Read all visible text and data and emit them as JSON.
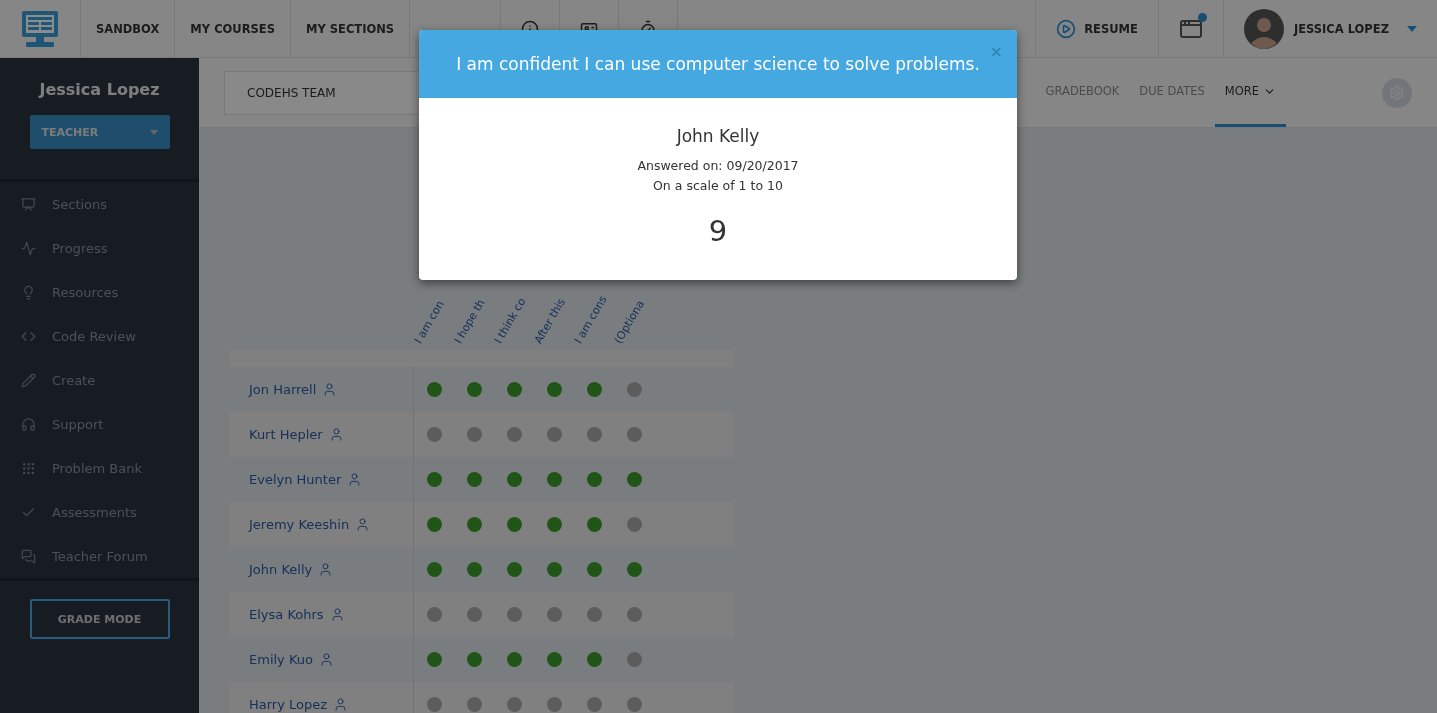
{
  "top_nav": {
    "links": [
      "SANDBOX",
      "MY COURSES",
      "MY SECTIONS"
    ],
    "resume": "RESUME",
    "notification": true,
    "user": "JESSICA LOPEZ"
  },
  "sidebar": {
    "name": "Jessica Lopez",
    "role": "TEACHER",
    "items": [
      "Sections",
      "Progress",
      "Resources",
      "Code Review",
      "Create",
      "Support",
      "Problem Bank",
      "Assessments",
      "Teacher Forum"
    ],
    "grade_mode": "GRADE MODE"
  },
  "subheader": {
    "section_select": "CODEHS TEAM",
    "tabs": [
      {
        "label": "GRADEBOOK",
        "selected": false,
        "menu": false
      },
      {
        "label": "DUE DATES",
        "selected": false,
        "menu": false
      },
      {
        "label": "MORE",
        "selected": true,
        "menu": true
      }
    ]
  },
  "table": {
    "columns": [
      "I am con",
      "I hope th",
      "I think co",
      "After this",
      "I am cons",
      "(Optiona"
    ],
    "rows": [
      {
        "name": "Jon Harrell",
        "answers": [
          true,
          true,
          true,
          true,
          true,
          false
        ]
      },
      {
        "name": "Kurt Hepler",
        "answers": [
          false,
          false,
          false,
          false,
          false,
          false
        ]
      },
      {
        "name": "Evelyn Hunter",
        "answers": [
          true,
          true,
          true,
          true,
          true,
          true
        ]
      },
      {
        "name": "Jeremy Keeshin",
        "answers": [
          true,
          true,
          true,
          true,
          true,
          false
        ]
      },
      {
        "name": "John Kelly",
        "answers": [
          true,
          true,
          true,
          true,
          true,
          true
        ]
      },
      {
        "name": "Elysa Kohrs",
        "answers": [
          false,
          false,
          false,
          false,
          false,
          false
        ]
      },
      {
        "name": "Emily Kuo",
        "answers": [
          true,
          true,
          true,
          true,
          true,
          false
        ]
      },
      {
        "name": "Harry Lopez",
        "answers": [
          false,
          false,
          false,
          false,
          false,
          false
        ]
      }
    ]
  },
  "modal": {
    "title": "I am confident I can use computer science to solve problems.",
    "close": "×",
    "student": "John Kelly",
    "answered_on": "Answered on: 09/20/2017",
    "scale": "On a scale of 1 to 10",
    "answer": "9"
  }
}
